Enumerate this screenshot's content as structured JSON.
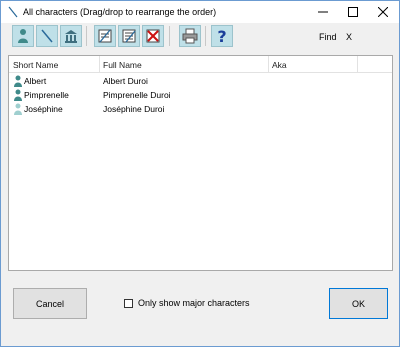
{
  "window": {
    "title": "All characters (Drag/drop to rearrange the order)",
    "controls": [
      "minimize-icon",
      "maximize-icon",
      "close-icon"
    ]
  },
  "toolbar": {
    "buttons": [
      {
        "icon": "person-icon"
      },
      {
        "icon": "quill-pen-icon"
      },
      {
        "icon": "building-icon"
      },
      {
        "icon": "new-character-icon"
      },
      {
        "icon": "edit-character-icon"
      },
      {
        "icon": "delete-character-icon"
      },
      {
        "icon": "print-icon"
      },
      {
        "icon": "help-icon",
        "label": "?"
      }
    ],
    "find_label": "Find",
    "find_clear": "X"
  },
  "list": {
    "columns": [
      "Short Name",
      "Full Name",
      "Aka"
    ],
    "rows": [
      {
        "short": "Albert",
        "full": "Albert Duroi",
        "aka": "",
        "icon": "person-icon"
      },
      {
        "short": "Pimprenelle",
        "full": "Pimprenelle Duroi",
        "aka": "",
        "icon": "person-icon"
      },
      {
        "short": "Joséphine",
        "full": "Joséphine Duroi",
        "aka": "",
        "icon": "person-icon"
      }
    ]
  },
  "footer": {
    "cancel_label": "Cancel",
    "checkbox_label": "Only show major characters",
    "checkbox_checked": false,
    "ok_label": "OK"
  },
  "colors": {
    "toolbar_button": "#bfe0e8",
    "person_icon": "#3f8a8a",
    "person_icon_light": "#9fcfcf",
    "ok_border": "#0078d7"
  }
}
